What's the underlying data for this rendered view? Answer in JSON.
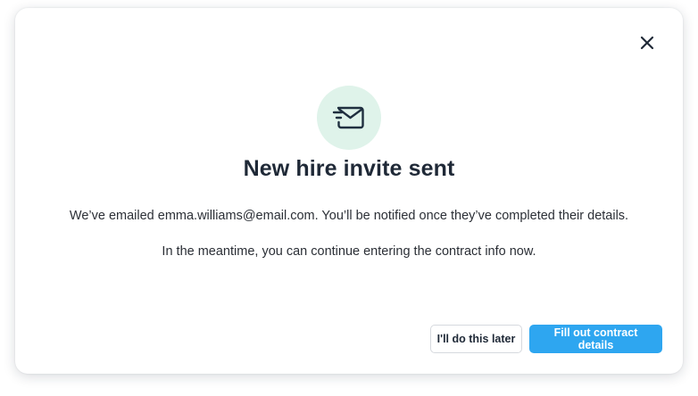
{
  "modal": {
    "icon": "envelope-sent-icon",
    "close_icon": "close-icon",
    "title": "New hire invite sent",
    "description_line1": "We’ve emailed emma.williams@email.com. You’ll be notified once they’ve completed their details.",
    "description_line2": "In the meantime, you can continue entering the contract info now.",
    "secondary_button_label": "I'll do this later",
    "primary_button_label": "Fill out contract details"
  },
  "colors": {
    "primary": "#2ea6f0",
    "icon_bg": "#dff3ea",
    "icon_stroke": "#1f2f3f",
    "text": "#1f2937"
  }
}
